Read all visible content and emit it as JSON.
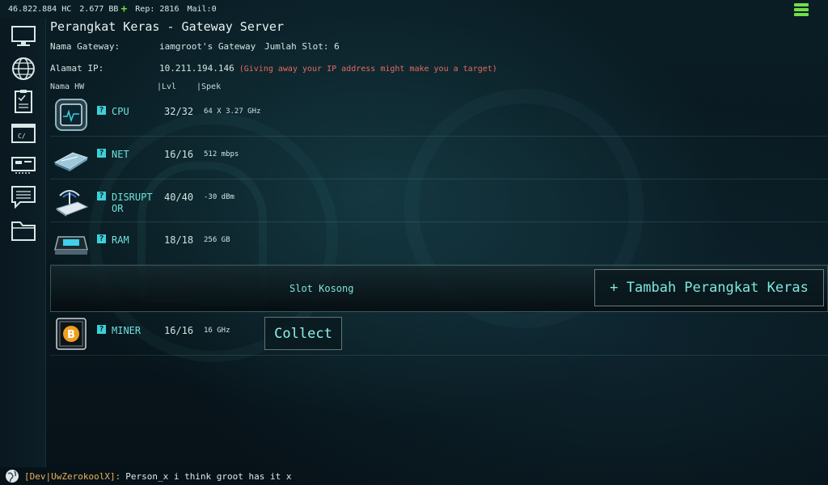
{
  "status": {
    "hc": "46.822.884 HC",
    "bb": "2.677 BB",
    "rep": "Rep: 2816",
    "mail": "Mail:0"
  },
  "header": {
    "title": "Perangkat Keras - Gateway Server",
    "gateway_label": "Nama Gateway:",
    "gateway_value": "iamgroot's Gateway",
    "slots": "Jumlah Slot: 6",
    "ip_label": "Alamat IP:",
    "ip_value": "10.211.194.146",
    "ip_warning": "(Giving away your IP address might make you a target)"
  },
  "columns": {
    "name": "Nama HW",
    "level": "|Lvl",
    "spec": "|Spek"
  },
  "hardware": [
    {
      "name": "CPU",
      "level": "32/32",
      "spec": "64 X 3.27 GHz",
      "icon": "cpu-icon"
    },
    {
      "name": "NET",
      "level": "16/16",
      "spec": "512 mbps",
      "icon": "network-card-icon"
    },
    {
      "name": "DISRUPT OR",
      "level": "40/40",
      "spec": "-30 dBm",
      "icon": "router-icon"
    },
    {
      "name": "RAM",
      "level": "18/18",
      "spec": "256 GB",
      "icon": "ram-icon"
    }
  ],
  "empty_slot": {
    "label": "Slot Kosong",
    "add_button": "+ Tambah Perangkat Keras"
  },
  "miner": {
    "name": "MINER",
    "level": "16/16",
    "spec": "16 GHz",
    "collect": "Collect"
  },
  "chat": {
    "user": "[Dev|UwZerokoolX]:",
    "message": "Person_x i think groot has it x"
  },
  "colors": {
    "accent": "#6fe3dc",
    "warning": "#e66a5c",
    "plus": "#6dde3c",
    "chat_user": "#e9b15a"
  }
}
